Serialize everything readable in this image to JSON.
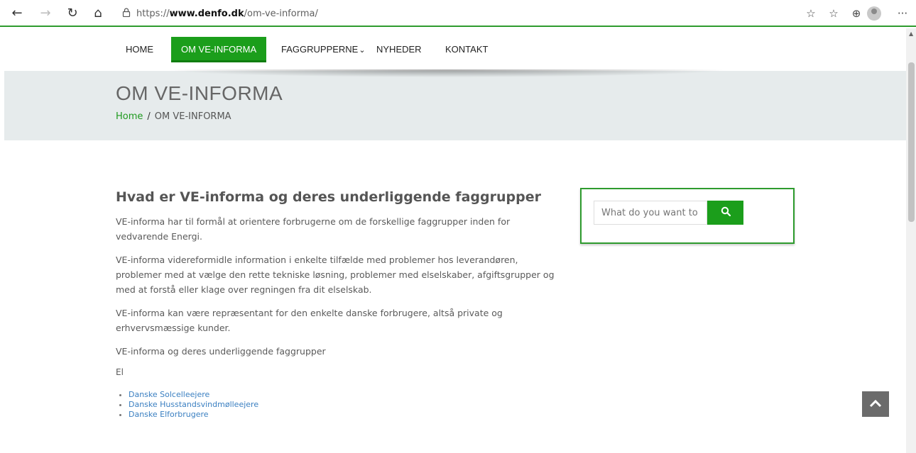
{
  "browser": {
    "url_prefix": "https://",
    "url_domain": "www.denfo.dk",
    "url_path": "/om-ve-informa/",
    "icons": {
      "back": "←",
      "forward": "→",
      "reload": "↻",
      "home": "⌂",
      "lock": "🔒",
      "favorite_add": "☆",
      "favorites": "☆",
      "collections": "⊕",
      "menu": "···"
    }
  },
  "nav": {
    "items": [
      "HOME",
      "OM VE-INFORMA",
      "FAGGRUPPERNE",
      "NYHEDER",
      "KONTAKT"
    ],
    "dropdown_glyph": "⌄"
  },
  "header": {
    "title": "OM VE-INFORMA",
    "breadcrumb_home": "Home",
    "breadcrumb_sep": "/",
    "breadcrumb_current": "OM VE-INFORMA"
  },
  "content": {
    "heading": "Hvad er VE-informa og deres underliggende faggrupper",
    "paragraphs": [
      "VE-informa har til formål at orientere forbrugerne om de forskellige faggrupper inden for vedvarende Energi.",
      "VE-informa  videreformidle information i enkelte tilfælde med problemer hos leverandøren, problemer med at vælge den rette tekniske løsning, problemer med elselskaber, afgiftsgrupper og med at forstå eller klage over regningen fra dit elselskab.",
      "VE-informa kan være repræsentant for den enkelte danske forbrugere, altså private og erhvervsmæssige kunder.",
      "VE-informa og deres underliggende faggrupper"
    ],
    "group_label": "El",
    "links": [
      "Danske Solcelleejere",
      "Danske Husstandsvindmølleejere",
      "Danske Elforbrugere"
    ]
  },
  "search": {
    "placeholder": "What do you want to",
    "button_glyph": "🔍"
  },
  "back_to_top_glyph": "▲",
  "colors": {
    "accent": "#1b9e1b",
    "header_bg": "#e6ebec",
    "link": "#3a7fc1"
  }
}
